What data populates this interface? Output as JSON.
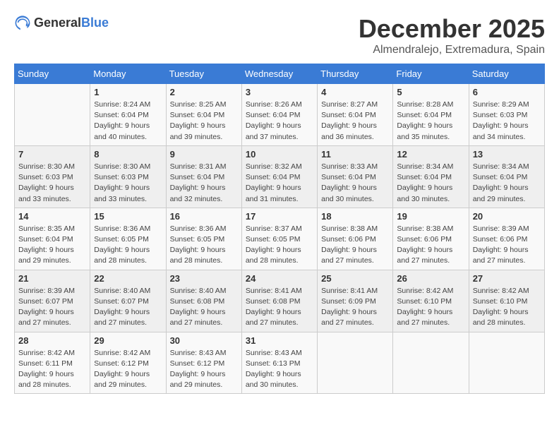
{
  "logo": {
    "general": "General",
    "blue": "Blue"
  },
  "title": "December 2025",
  "location": "Almendralejo, Extremadura, Spain",
  "weekdays": [
    "Sunday",
    "Monday",
    "Tuesday",
    "Wednesday",
    "Thursday",
    "Friday",
    "Saturday"
  ],
  "weeks": [
    [
      {
        "day": "",
        "detail": ""
      },
      {
        "day": "1",
        "detail": "Sunrise: 8:24 AM\nSunset: 6:04 PM\nDaylight: 9 hours\nand 40 minutes."
      },
      {
        "day": "2",
        "detail": "Sunrise: 8:25 AM\nSunset: 6:04 PM\nDaylight: 9 hours\nand 39 minutes."
      },
      {
        "day": "3",
        "detail": "Sunrise: 8:26 AM\nSunset: 6:04 PM\nDaylight: 9 hours\nand 37 minutes."
      },
      {
        "day": "4",
        "detail": "Sunrise: 8:27 AM\nSunset: 6:04 PM\nDaylight: 9 hours\nand 36 minutes."
      },
      {
        "day": "5",
        "detail": "Sunrise: 8:28 AM\nSunset: 6:04 PM\nDaylight: 9 hours\nand 35 minutes."
      },
      {
        "day": "6",
        "detail": "Sunrise: 8:29 AM\nSunset: 6:03 PM\nDaylight: 9 hours\nand 34 minutes."
      }
    ],
    [
      {
        "day": "7",
        "detail": "Sunrise: 8:30 AM\nSunset: 6:03 PM\nDaylight: 9 hours\nand 33 minutes."
      },
      {
        "day": "8",
        "detail": "Sunrise: 8:30 AM\nSunset: 6:03 PM\nDaylight: 9 hours\nand 33 minutes."
      },
      {
        "day": "9",
        "detail": "Sunrise: 8:31 AM\nSunset: 6:04 PM\nDaylight: 9 hours\nand 32 minutes."
      },
      {
        "day": "10",
        "detail": "Sunrise: 8:32 AM\nSunset: 6:04 PM\nDaylight: 9 hours\nand 31 minutes."
      },
      {
        "day": "11",
        "detail": "Sunrise: 8:33 AM\nSunset: 6:04 PM\nDaylight: 9 hours\nand 30 minutes."
      },
      {
        "day": "12",
        "detail": "Sunrise: 8:34 AM\nSunset: 6:04 PM\nDaylight: 9 hours\nand 30 minutes."
      },
      {
        "day": "13",
        "detail": "Sunrise: 8:34 AM\nSunset: 6:04 PM\nDaylight: 9 hours\nand 29 minutes."
      }
    ],
    [
      {
        "day": "14",
        "detail": "Sunrise: 8:35 AM\nSunset: 6:04 PM\nDaylight: 9 hours\nand 29 minutes."
      },
      {
        "day": "15",
        "detail": "Sunrise: 8:36 AM\nSunset: 6:05 PM\nDaylight: 9 hours\nand 28 minutes."
      },
      {
        "day": "16",
        "detail": "Sunrise: 8:36 AM\nSunset: 6:05 PM\nDaylight: 9 hours\nand 28 minutes."
      },
      {
        "day": "17",
        "detail": "Sunrise: 8:37 AM\nSunset: 6:05 PM\nDaylight: 9 hours\nand 28 minutes."
      },
      {
        "day": "18",
        "detail": "Sunrise: 8:38 AM\nSunset: 6:06 PM\nDaylight: 9 hours\nand 27 minutes."
      },
      {
        "day": "19",
        "detail": "Sunrise: 8:38 AM\nSunset: 6:06 PM\nDaylight: 9 hours\nand 27 minutes."
      },
      {
        "day": "20",
        "detail": "Sunrise: 8:39 AM\nSunset: 6:06 PM\nDaylight: 9 hours\nand 27 minutes."
      }
    ],
    [
      {
        "day": "21",
        "detail": "Sunrise: 8:39 AM\nSunset: 6:07 PM\nDaylight: 9 hours\nand 27 minutes."
      },
      {
        "day": "22",
        "detail": "Sunrise: 8:40 AM\nSunset: 6:07 PM\nDaylight: 9 hours\nand 27 minutes."
      },
      {
        "day": "23",
        "detail": "Sunrise: 8:40 AM\nSunset: 6:08 PM\nDaylight: 9 hours\nand 27 minutes."
      },
      {
        "day": "24",
        "detail": "Sunrise: 8:41 AM\nSunset: 6:08 PM\nDaylight: 9 hours\nand 27 minutes."
      },
      {
        "day": "25",
        "detail": "Sunrise: 8:41 AM\nSunset: 6:09 PM\nDaylight: 9 hours\nand 27 minutes."
      },
      {
        "day": "26",
        "detail": "Sunrise: 8:42 AM\nSunset: 6:10 PM\nDaylight: 9 hours\nand 27 minutes."
      },
      {
        "day": "27",
        "detail": "Sunrise: 8:42 AM\nSunset: 6:10 PM\nDaylight: 9 hours\nand 28 minutes."
      }
    ],
    [
      {
        "day": "28",
        "detail": "Sunrise: 8:42 AM\nSunset: 6:11 PM\nDaylight: 9 hours\nand 28 minutes."
      },
      {
        "day": "29",
        "detail": "Sunrise: 8:42 AM\nSunset: 6:12 PM\nDaylight: 9 hours\nand 29 minutes."
      },
      {
        "day": "30",
        "detail": "Sunrise: 8:43 AM\nSunset: 6:12 PM\nDaylight: 9 hours\nand 29 minutes."
      },
      {
        "day": "31",
        "detail": "Sunrise: 8:43 AM\nSunset: 6:13 PM\nDaylight: 9 hours\nand 30 minutes."
      },
      {
        "day": "",
        "detail": ""
      },
      {
        "day": "",
        "detail": ""
      },
      {
        "day": "",
        "detail": ""
      }
    ]
  ]
}
